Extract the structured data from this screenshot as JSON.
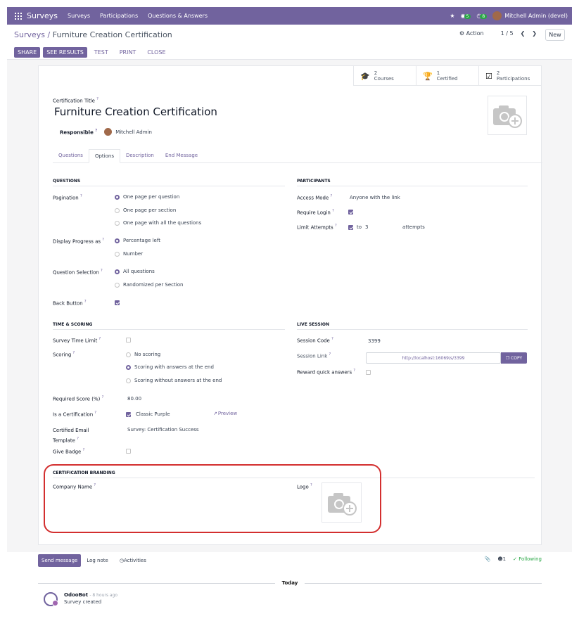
{
  "navbar": {
    "brand": "Surveys",
    "menu": [
      "Surveys",
      "Participations",
      "Questions & Answers"
    ],
    "messages_count": "5",
    "activities_count": "8",
    "user": "Mitchell Admin (devel)"
  },
  "breadcrumb": {
    "parent": "Surveys",
    "separator": "/",
    "current": "Furniture Creation Certification"
  },
  "control": {
    "action_label": "Action",
    "pager": "1 / 5",
    "new_label": "New"
  },
  "actions": {
    "share": "SHARE",
    "see_results": "SEE RESULTS",
    "test": "TEST",
    "print": "PRINT",
    "close": "CLOSE"
  },
  "stats": [
    {
      "value": "2",
      "label": "Courses"
    },
    {
      "value": "1",
      "label": "Certified"
    },
    {
      "value": "2",
      "label": "Participations"
    }
  ],
  "form": {
    "title_label": "Certification Title",
    "title": "Furniture Creation Certification",
    "responsible_label": "Responsible",
    "responsible": "Mitchell Admin"
  },
  "tabs": [
    "Questions",
    "Options",
    "Description",
    "End Message"
  ],
  "questions": {
    "header": "QUESTIONS",
    "pagination_label": "Pagination",
    "pagination_options": [
      "One page per question",
      "One page per section",
      "One page with all the questions"
    ],
    "progress_label": "Display Progress as",
    "progress_options": [
      "Percentage left",
      "Number"
    ],
    "selection_label": "Question Selection",
    "selection_options": [
      "All questions",
      "Randomized per Section"
    ],
    "back_label": "Back Button"
  },
  "participants": {
    "header": "PARTICIPANTS",
    "access_label": "Access Mode",
    "access_value": "Anyone with the link",
    "login_label": "Require Login",
    "limit_label": "Limit Attempts",
    "limit_to": "to",
    "limit_count": "3",
    "limit_suffix": "attempts"
  },
  "time_scoring": {
    "header": "TIME & SCORING",
    "time_limit_label": "Survey Time Limit",
    "scoring_label": "Scoring",
    "scoring_options": [
      "No scoring",
      "Scoring with answers at the end",
      "Scoring without answers at the end"
    ],
    "required_label": "Required Score (%)",
    "required_value": "80.00",
    "certification_label": "Is a Certification",
    "certification_value": "Classic Purple",
    "preview_label": "Preview",
    "email_label": "Certified Email Template",
    "email_value": "Survey: Certification Success",
    "badge_label": "Give Badge"
  },
  "live_session": {
    "header": "LIVE SESSION",
    "code_label": "Session Code",
    "code_value": "3399",
    "link_label": "Session Link",
    "link_value": "http://localhost:16069/s/3399",
    "copy_label": "COPY",
    "reward_label": "Reward quick answers"
  },
  "branding": {
    "header": "CERTIFICATION BRANDING",
    "company_label": "Company Name",
    "logo_label": "Logo"
  },
  "chatter": {
    "send": "Send message",
    "log": "Log note",
    "activities": "Activities",
    "followers": "1",
    "following": "Following",
    "today": "Today",
    "author": "OdooBot",
    "time": "- 8 hours ago",
    "body": "Survey created"
  },
  "colors": {
    "brand": "#71639e",
    "highlight": "#d32f2f",
    "following": "#28a745"
  }
}
